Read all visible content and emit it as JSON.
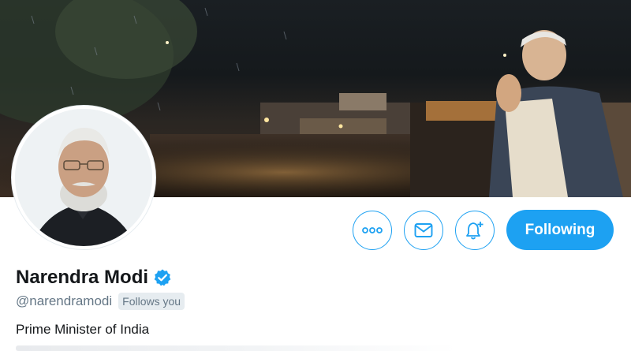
{
  "profile": {
    "display_name": "Narendra Modi",
    "handle": "@narendramodi",
    "follows_you_label": "Follows you",
    "bio": "Prime Minister of India",
    "verified": true
  },
  "actions": {
    "more_icon": "more-dots-icon",
    "message_icon": "envelope-icon",
    "notify_icon": "bell-plus-icon",
    "follow_label": "Following"
  },
  "colors": {
    "accent": "#1da1f2",
    "text_primary": "#14171a",
    "text_secondary": "#657786",
    "badge_bg": "#e6ecf0"
  }
}
